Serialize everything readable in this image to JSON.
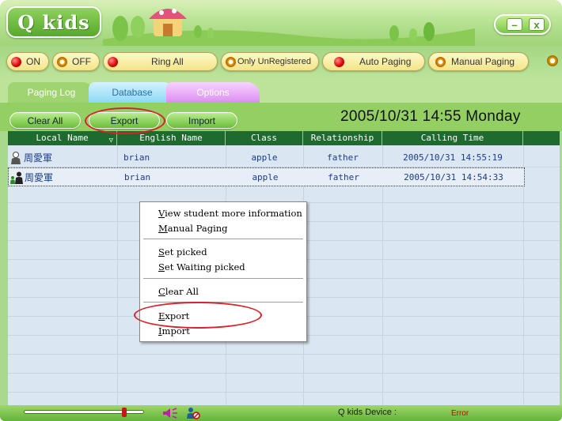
{
  "app": {
    "title": "Q kids"
  },
  "window_controls": {
    "minimize": "–",
    "close": "x"
  },
  "controls": [
    {
      "label": "ON",
      "indicator": "red"
    },
    {
      "label": "OFF",
      "indicator": "ring"
    },
    {
      "label": "Ring All",
      "indicator": "red"
    },
    {
      "label": "Only UnRegistered",
      "indicator": "ring"
    },
    {
      "label": "Auto Paging",
      "indicator": "red"
    },
    {
      "label": "Manual Paging",
      "indicator": "ring"
    }
  ],
  "tabs": [
    {
      "label": "Paging Log",
      "active": true
    },
    {
      "label": "Database",
      "active": false
    },
    {
      "label": "Options",
      "active": false
    }
  ],
  "toolbar": {
    "clear_all": "Clear All",
    "export": "Export",
    "import": "Import",
    "datetime": "2005/10/31  14:55  Monday"
  },
  "table": {
    "headers": [
      "Local Name",
      "English Name",
      "Class",
      "Relationship",
      "Calling Time"
    ],
    "rows": [
      {
        "local": "周愛軍",
        "english": "brian",
        "class": "apple",
        "relationship": "father",
        "time": "2005/10/31 14:55:19",
        "icon": "person-icon"
      },
      {
        "local": "周愛軍",
        "english": "brian",
        "class": "apple",
        "relationship": "father",
        "time": "2005/10/31 14:54:33",
        "icon": "parent-child-icon"
      }
    ]
  },
  "context_menu": {
    "items": [
      "View student more information",
      "Manual Paging",
      "Set picked",
      "Set Waiting picked",
      "Clear All",
      "Export",
      "Import"
    ]
  },
  "statusbar": {
    "volume_level": 1.0,
    "device_label": "Q kids Device :",
    "device_status": "Error",
    "status_color": "#d40000"
  },
  "colors": {
    "accent_green": "#93cf62",
    "header_green": "#1f6a2e",
    "annotation_red": "#d8222a"
  }
}
